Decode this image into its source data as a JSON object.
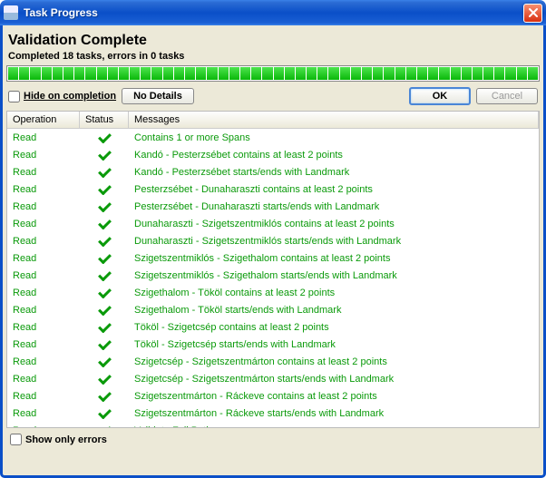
{
  "window": {
    "title": "Task Progress"
  },
  "header": {
    "heading": "Validation Complete",
    "subheading": "Completed 18 tasks, errors in 0 tasks"
  },
  "controls": {
    "hide_on_completion_label": "Hide on completion",
    "hide_on_completion_checked": false,
    "no_details_label": "No Details",
    "ok_label": "OK",
    "cancel_label": "Cancel"
  },
  "table": {
    "headers": {
      "operation": "Operation",
      "status": "Status",
      "messages": "Messages"
    },
    "rows": [
      {
        "op": "Read",
        "status": "ok",
        "msg": "Contains 1 or more Spans"
      },
      {
        "op": "Read",
        "status": "ok",
        "msg": "Kandó - Pesterzsébet contains at least 2 points"
      },
      {
        "op": "Read",
        "status": "ok",
        "msg": "Kandó - Pesterzsébet starts/ends with Landmark"
      },
      {
        "op": "Read",
        "status": "ok",
        "msg": "Pesterzsébet - Dunaharaszti contains at least 2 points"
      },
      {
        "op": "Read",
        "status": "ok",
        "msg": "Pesterzsébet - Dunaharaszti starts/ends with Landmark"
      },
      {
        "op": "Read",
        "status": "ok",
        "msg": "Dunaharaszti - Szigetszentmiklós contains at least 2 points"
      },
      {
        "op": "Read",
        "status": "ok",
        "msg": "Dunaharaszti - Szigetszentmiklós starts/ends with Landmark"
      },
      {
        "op": "Read",
        "status": "ok",
        "msg": "Szigetszentmiklós - Szigethalom contains at least 2 points"
      },
      {
        "op": "Read",
        "status": "ok",
        "msg": "Szigetszentmiklós - Szigethalom starts/ends with Landmark"
      },
      {
        "op": "Read",
        "status": "ok",
        "msg": "Szigethalom - Tököl contains at least 2 points"
      },
      {
        "op": "Read",
        "status": "ok",
        "msg": "Szigethalom - Tököl starts/ends with Landmark"
      },
      {
        "op": "Read",
        "status": "ok",
        "msg": "Tököl - Szigetcsép contains at least 2 points"
      },
      {
        "op": "Read",
        "status": "ok",
        "msg": "Tököl - Szigetcsép starts/ends with Landmark"
      },
      {
        "op": "Read",
        "status": "ok",
        "msg": "Szigetcsép - Szigetszentmárton contains at least 2 points"
      },
      {
        "op": "Read",
        "status": "ok",
        "msg": "Szigetcsép - Szigetszentmárton starts/ends with Landmark"
      },
      {
        "op": "Read",
        "status": "ok",
        "msg": "Szigetszentmárton - Ráckeve contains at least 2 points"
      },
      {
        "op": "Read",
        "status": "ok",
        "msg": "Szigetszentmárton - Ráckeve starts/ends with Landmark"
      },
      {
        "op": "Read",
        "status": "ok",
        "msg": "Validate Full Path"
      }
    ]
  },
  "footer": {
    "show_only_errors_label": "Show only errors",
    "show_only_errors_checked": false
  },
  "progress": {
    "percent": 100,
    "segments": 48
  }
}
